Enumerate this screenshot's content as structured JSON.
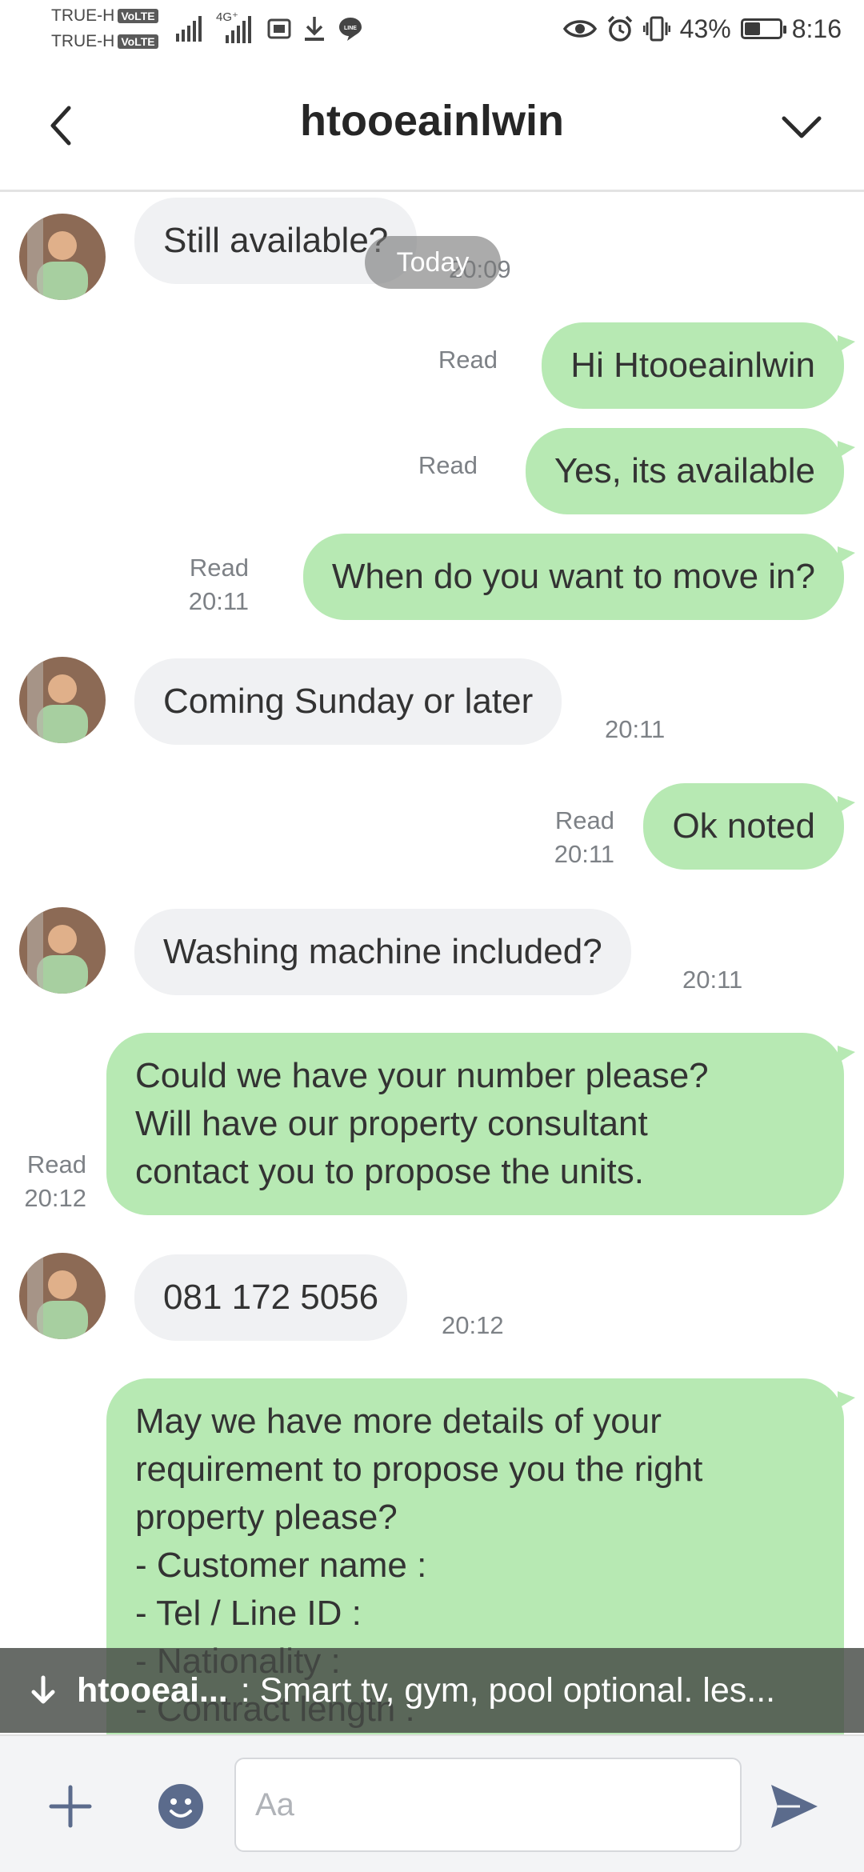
{
  "status_bar": {
    "carrier_1": "TRUE-H",
    "carrier_2": "TRUE-H",
    "volte_badge": "VoLTE",
    "network_label": "4G⁺",
    "battery_percent": "43%",
    "battery_level": 0.43,
    "time": "8:16"
  },
  "header": {
    "title": "htooeainlwin"
  },
  "chat": {
    "date_pill": "Today",
    "messages": [
      {
        "side": "in",
        "text": "Still available?",
        "time": "20:09"
      },
      {
        "side": "out",
        "text": "Hi Htooeainlwin",
        "status": "Read"
      },
      {
        "side": "out",
        "text": "Yes, its available",
        "status": "Read"
      },
      {
        "side": "out",
        "text": "When do you want to move in?",
        "status": "Read",
        "time": "20:11"
      },
      {
        "side": "in",
        "text": "Coming Sunday or later",
        "time": "20:11"
      },
      {
        "side": "out",
        "text": "Ok noted",
        "status": "Read",
        "time": "20:11"
      },
      {
        "side": "in",
        "text": "Washing machine included?",
        "time": "20:11"
      },
      {
        "side": "out",
        "text": "Could we have your number please?\nWill have our property consultant\ncontact you to propose the units.",
        "status": "Read",
        "time": "20:12"
      },
      {
        "side": "in",
        "text": "081 172 5056",
        "time": "20:12"
      },
      {
        "side": "out",
        "text": "May we have more details of your\nrequirement to propose you the right\nproperty please?\n- Customer name :\n- Tel / Line ID :\n- Nationality :\n- Contract length :"
      }
    ]
  },
  "notification": {
    "sender": "htooeai...",
    "text": ": Smart tv, gym, pool optional. les..."
  },
  "input": {
    "placeholder": "Aa"
  },
  "colors": {
    "outgoing_bubble": "#b7e9b3",
    "incoming_bubble": "#f0f1f3",
    "icon_accent": "#5b6b8c"
  },
  "icons": [
    "back-arrow-icon",
    "chevron-down-icon",
    "plus-icon",
    "emoji-icon",
    "send-icon",
    "download-arrow-icon",
    "eye-icon",
    "alarm-icon",
    "vibrate-icon",
    "battery-icon",
    "signal-icon",
    "line-icon"
  ]
}
